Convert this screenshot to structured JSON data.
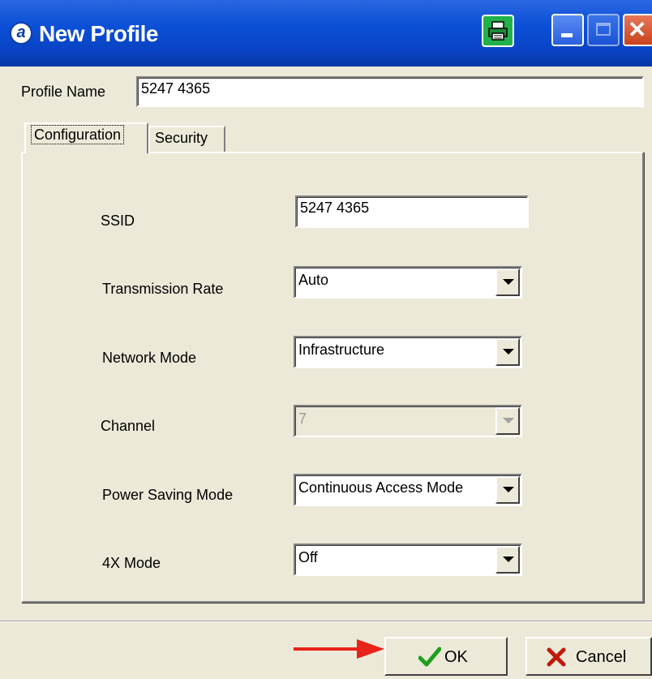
{
  "window": {
    "title": "New Profile",
    "app_icon": "a",
    "icons": [
      "app-icon",
      "print-icon",
      "minimize-icon",
      "maximize-icon",
      "close-icon"
    ]
  },
  "profile_name": {
    "label": "Profile Name",
    "value": "5247 4365"
  },
  "tabs": [
    {
      "label": "Configuration",
      "selected": true
    },
    {
      "label": "Security",
      "selected": false
    }
  ],
  "config": {
    "ssid": {
      "label": "SSID",
      "value": "5247 4365"
    },
    "transmission_rate": {
      "label": "Transmission Rate",
      "value": "Auto"
    },
    "network_mode": {
      "label": "Network Mode",
      "value": "Infrastructure"
    },
    "channel": {
      "label": "Channel",
      "value": "7",
      "disabled": true
    },
    "power_saving_mode": {
      "label": "Power Saving Mode",
      "value": "Continuous Access Mode"
    },
    "four_x_mode": {
      "label": "4X Mode",
      "value": "Off"
    }
  },
  "buttons": {
    "ok": "OK",
    "cancel": "Cancel"
  },
  "colors": {
    "titlebar": "#0A4FD6",
    "print_button": "#21B14B",
    "close_button": "#D9552F",
    "annotation_arrow": "#E8231A",
    "ok_check": "#1E9E1E",
    "cancel_x": "#C0180C"
  }
}
